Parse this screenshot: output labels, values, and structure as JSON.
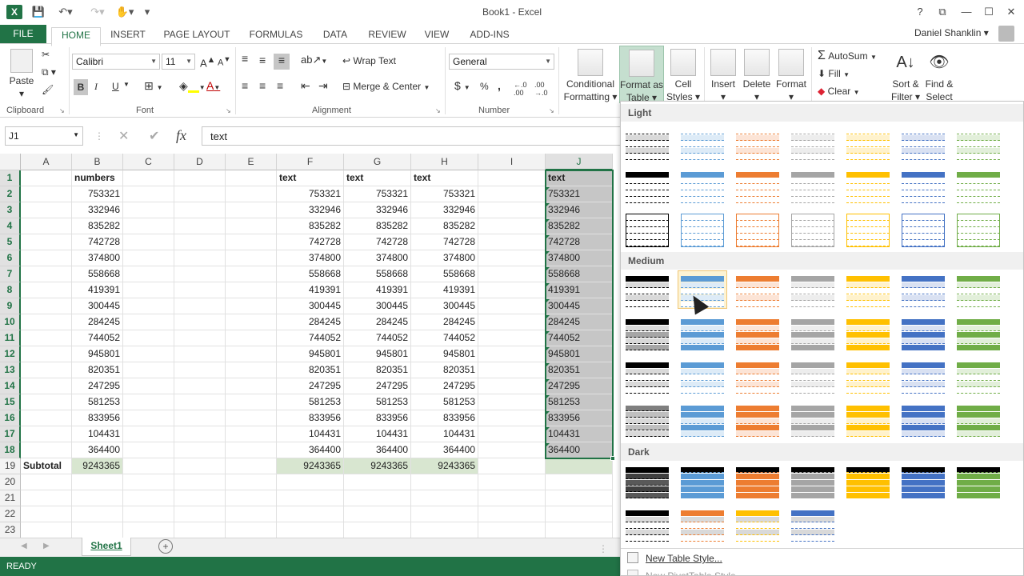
{
  "window": {
    "title": "Book1 - Excel",
    "user": "Daniel Shanklin"
  },
  "tabs": [
    "FILE",
    "HOME",
    "INSERT",
    "PAGE LAYOUT",
    "FORMULAS",
    "DATA",
    "REVIEW",
    "VIEW",
    "ADD-INS"
  ],
  "ribbon": {
    "clipboard": {
      "paste": "Paste",
      "label": "Clipboard"
    },
    "font": {
      "name": "Calibri",
      "size": "11",
      "label": "Font",
      "bold": "B",
      "italic": "I",
      "underline": "U"
    },
    "alignment": {
      "wrap": "Wrap Text",
      "merge": "Merge & Center",
      "label": "Alignment"
    },
    "number": {
      "format": "General",
      "label": "Number",
      "currency": "$",
      "percent": "%",
      "comma": ","
    },
    "styles": {
      "cond1": "Conditional",
      "cond2": "Formatting",
      "fat1": "Format as",
      "fat2": "Table",
      "cell1": "Cell",
      "cell2": "Styles"
    },
    "cells": {
      "insert": "Insert",
      "delete": "Delete",
      "format": "Format"
    },
    "editing": {
      "autosum": "AutoSum",
      "fill": "Fill",
      "clear": "Clear",
      "sort1": "Sort &",
      "sort2": "Filter",
      "find1": "Find &",
      "find2": "Select"
    }
  },
  "formula_bar": {
    "name_box": "J1",
    "fx": "fx",
    "content": "text"
  },
  "columns": [
    "A",
    "B",
    "C",
    "D",
    "E",
    "F",
    "G",
    "H",
    "I",
    "J"
  ],
  "rows": [
    "1",
    "2",
    "3",
    "4",
    "5",
    "6",
    "7",
    "8",
    "9",
    "10",
    "11",
    "12",
    "13",
    "14",
    "15",
    "16",
    "17",
    "18",
    "19",
    "20",
    "21",
    "22",
    "23"
  ],
  "headers": {
    "B": "numbers",
    "F": "text",
    "G": "text",
    "H": "text",
    "J": "text"
  },
  "values": [
    "753321",
    "332946",
    "835282",
    "742728",
    "374800",
    "558668",
    "419391",
    "300445",
    "284245",
    "744052",
    "945801",
    "820351",
    "247295",
    "581253",
    "833956",
    "104431",
    "364400"
  ],
  "subtotal": {
    "label": "Subtotal",
    "B": "9243365",
    "F": "9243365",
    "G": "9243365",
    "H": "9243365"
  },
  "sheet_tab": "Sheet1",
  "status": "READY",
  "gallery": {
    "light": "Light",
    "medium": "Medium",
    "dark": "Dark",
    "new_table_style": "New Table Style...",
    "new_pivot_style": "New PivotTable Style...",
    "palette": [
      "#000000",
      "#5b9bd5",
      "#ed7d31",
      "#a5a5a5",
      "#ffc000",
      "#4472c4",
      "#70ad47"
    ],
    "tints": [
      "#d9d9d9",
      "#ddebf7",
      "#fce4d6",
      "#ededed",
      "#fff2cc",
      "#d9e1f2",
      "#e2efda"
    ]
  }
}
